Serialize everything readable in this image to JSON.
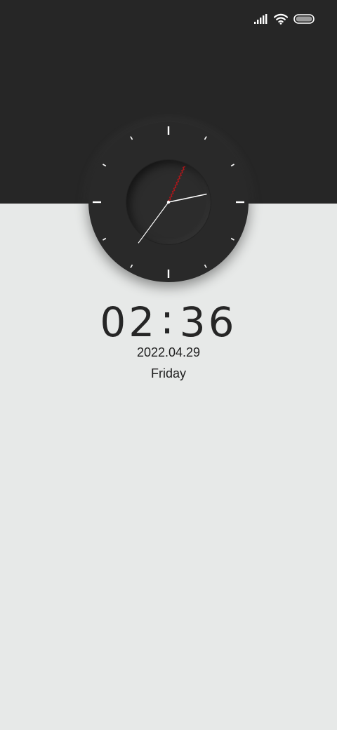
{
  "status_bar": {
    "icons": [
      "cellular-signal-icon",
      "wifi-icon",
      "battery-icon"
    ],
    "battery_level": 1.0
  },
  "clock": {
    "hours": 2,
    "minutes": 36,
    "seconds": 4,
    "second_hand_color": "#b2161a",
    "hand_color": "#ffffff",
    "face_color": "#292929"
  },
  "digital": {
    "hours": "02",
    "separator": ":",
    "minutes": "36"
  },
  "date": "2022.04.29",
  "day": "Friday",
  "colors": {
    "top_band": "#262626",
    "background": "#e7e9e8",
    "text": "#262626"
  }
}
